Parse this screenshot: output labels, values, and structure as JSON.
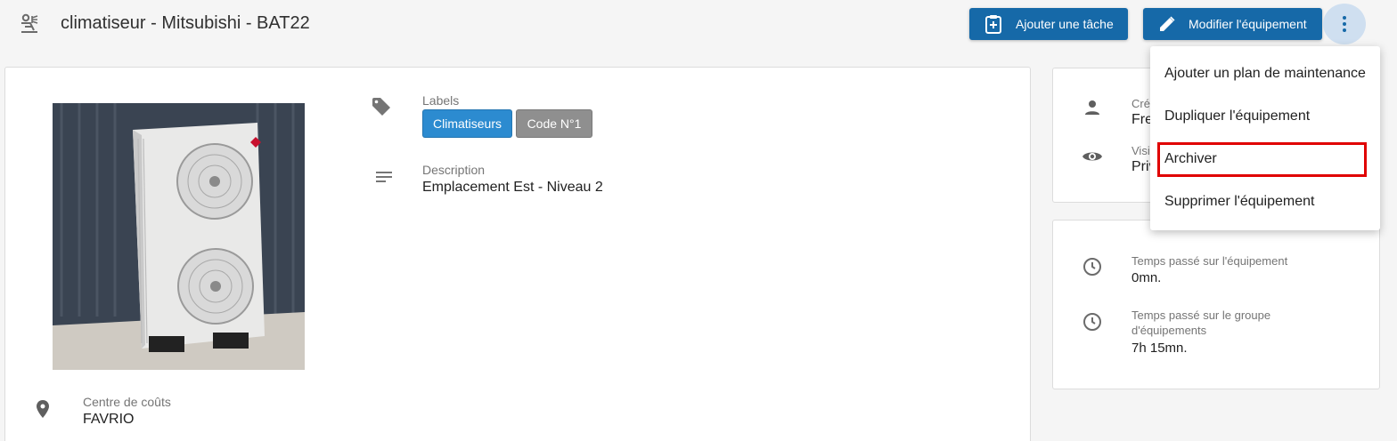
{
  "header": {
    "title": "climatiseur - Mitsubishi - BAT22",
    "add_task_label": "Ajouter une tâche",
    "edit_label": "Modifier l'équipement"
  },
  "main": {
    "labels_title": "Labels",
    "labels": [
      "Climatiseurs",
      "Code N°1"
    ],
    "description_title": "Description",
    "description": "Emplacement Est - Niveau 2",
    "cost_center_title": "Centre de coûts",
    "cost_center": "FAVRIO"
  },
  "info": {
    "created_label": "Cré",
    "created_value": "Fre",
    "visibility_label": "Visi",
    "visibility_value": "Priv"
  },
  "time": {
    "equipment_label": "Temps passé sur l'équipement",
    "equipment_value": "0mn.",
    "group_label_line1": "Temps passé sur le groupe",
    "group_label_line2": "d'équipements",
    "group_value": "7h 15mn."
  },
  "menu": {
    "items": [
      "Ajouter un plan de maintenance",
      "Dupliquer l'équipement",
      "Archiver",
      "Supprimer l'équipement"
    ]
  },
  "colors": {
    "primary": "#1669a8",
    "chip_blue": "#2c8bd0",
    "chip_grey": "#8f8f8f",
    "highlight": "#e00000"
  }
}
